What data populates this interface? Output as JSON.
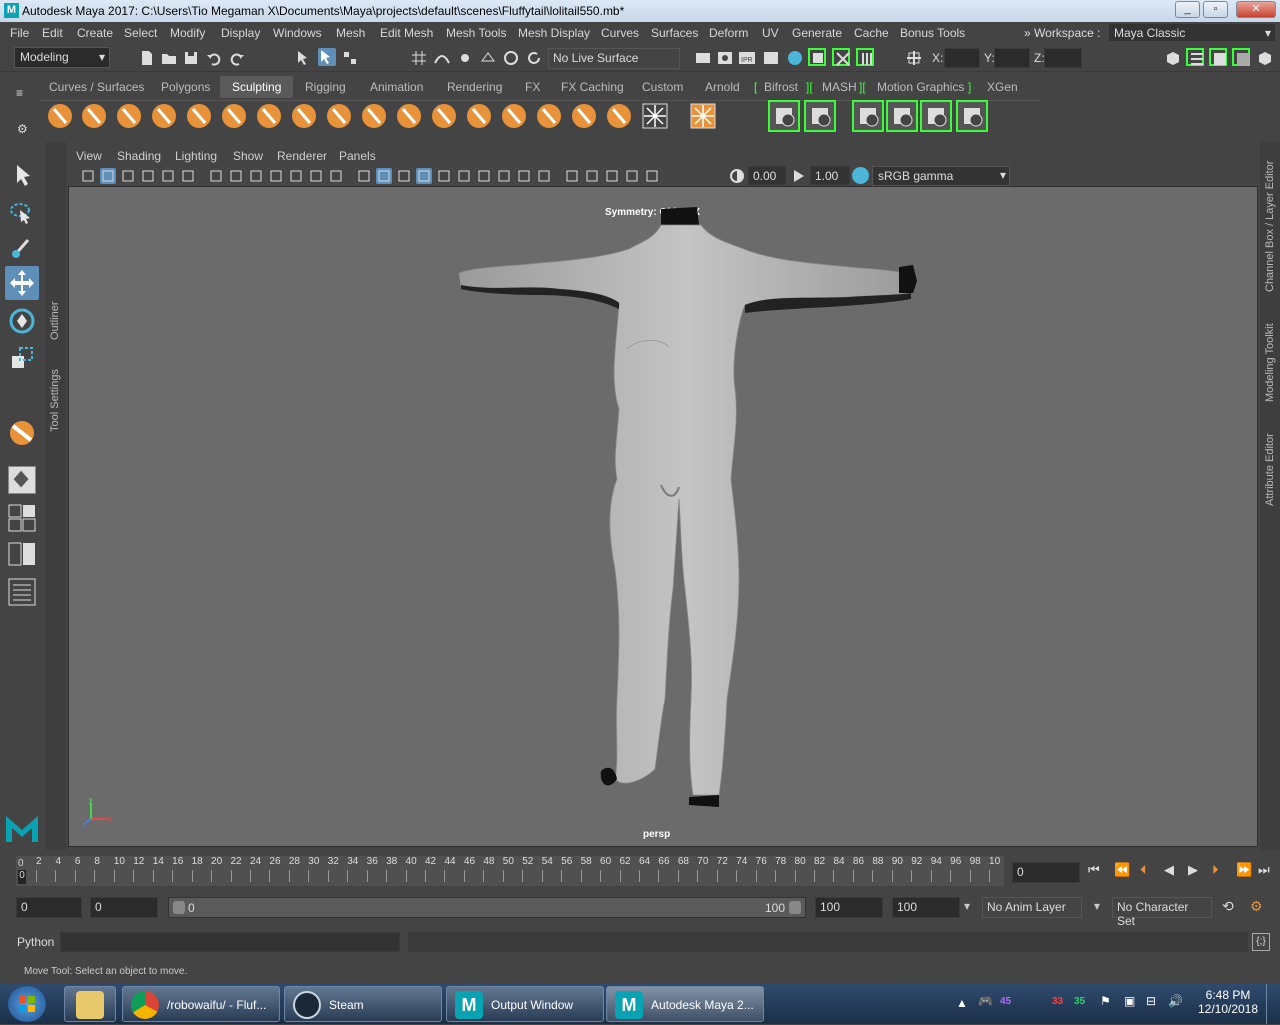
{
  "window": {
    "title": "Autodesk Maya 2017: C:\\Users\\Tio Megaman X\\Documents\\Maya\\projects\\default\\scenes\\Fluffytail\\lolitail550.mb*",
    "controls": [
      "minimize",
      "maximize",
      "close"
    ]
  },
  "menus": [
    "File",
    "Edit",
    "Create",
    "Select",
    "Modify",
    "Display",
    "Windows",
    "Mesh",
    "Edit Mesh",
    "Mesh Tools",
    "Mesh Display",
    "Curves",
    "Surfaces",
    "Deform",
    "UV",
    "Generate",
    "Cache",
    "Bonus Tools"
  ],
  "workspace": {
    "label": "Workspace :",
    "value": "Maya Classic"
  },
  "statusline": {
    "menuset": "Modeling",
    "live_surface": "No Live Surface",
    "x_label": "X:",
    "y_label": "Y:",
    "z_label": "Z:"
  },
  "shelf": {
    "tabs": [
      "Curves / Surfaces",
      "Polygons",
      "Sculpting",
      "Rigging",
      "Animation",
      "Rendering",
      "FX",
      "FX Caching",
      "Custom",
      "Arnold",
      "Bifrost",
      "MASH",
      "Motion Graphics",
      "XGen"
    ],
    "active_tab": "Sculpting",
    "icons": [
      "sculpt-icon",
      "smooth-icon",
      "relax-icon",
      "grab-icon",
      "pinch-icon",
      "flatten-icon",
      "foamy-icon",
      "spray-icon",
      "repeat-icon",
      "imprint-icon",
      "wax-icon",
      "scrape-icon",
      "fill-icon",
      "knife-icon",
      "smear-icon",
      "bulge-icon",
      "amplify-icon",
      "freeze-icon",
      "convert-to-frozen-icon"
    ]
  },
  "side_labels": {
    "left": [
      "Outliner",
      "Tool Settings"
    ],
    "right": [
      "Channel Box / Layer Editor",
      "Modeling Toolkit",
      "Attribute Editor"
    ]
  },
  "panel": {
    "menus": [
      "View",
      "Shading",
      "Lighting",
      "Show",
      "Renderer",
      "Panels"
    ],
    "exposure": "0.00",
    "gamma": "1.00",
    "color_space": "sRGB gamma"
  },
  "viewport": {
    "hud_symmetry": "Symmetry: Object X",
    "camera": "persp",
    "axis": {
      "x": "x",
      "y": "y",
      "z": "z"
    }
  },
  "timeline": {
    "ticks": [
      "2",
      "4",
      "6",
      "8",
      "10",
      "12",
      "14",
      "16",
      "18",
      "20",
      "22",
      "24",
      "26",
      "28",
      "30",
      "32",
      "34",
      "36",
      "38",
      "40",
      "42",
      "44",
      "46",
      "48",
      "50",
      "52",
      "54",
      "56",
      "58",
      "60",
      "62",
      "64",
      "66",
      "68",
      "70",
      "72",
      "74",
      "76",
      "78",
      "80",
      "82",
      "84",
      "86",
      "88",
      "90",
      "92",
      "94",
      "96",
      "98",
      "10"
    ],
    "zero": "0",
    "current_frame": "0",
    "current_frame_marker": "0"
  },
  "range": {
    "start": "0",
    "playback_start": "0",
    "slider_start": "0",
    "slider_end": "100",
    "playback_end": "100",
    "end": "100",
    "anim_layer": "No Anim Layer",
    "character_set": "No Character Set"
  },
  "cmdline": {
    "language": "Python"
  },
  "helpline": "Move Tool: Select an object to move.",
  "taskbar": {
    "items": [
      {
        "label": "/robowaifu/ - Fluf...",
        "icon": "chrome-icon"
      },
      {
        "label": "Steam",
        "icon": "steam-icon"
      },
      {
        "label": "Output Window",
        "icon": "maya-icon"
      },
      {
        "label": "Autodesk Maya 2...",
        "icon": "maya-icon"
      }
    ],
    "tray_numbers": [
      "45",
      "33",
      "35"
    ],
    "time": "6:48 PM",
    "date": "12/10/2018"
  },
  "colors": {
    "accent_green": "#39ff3a",
    "sculpt_orange": "#e8933a",
    "viewport_bg": "#6b6b6b",
    "maya_teal": "#0aa3b4"
  }
}
